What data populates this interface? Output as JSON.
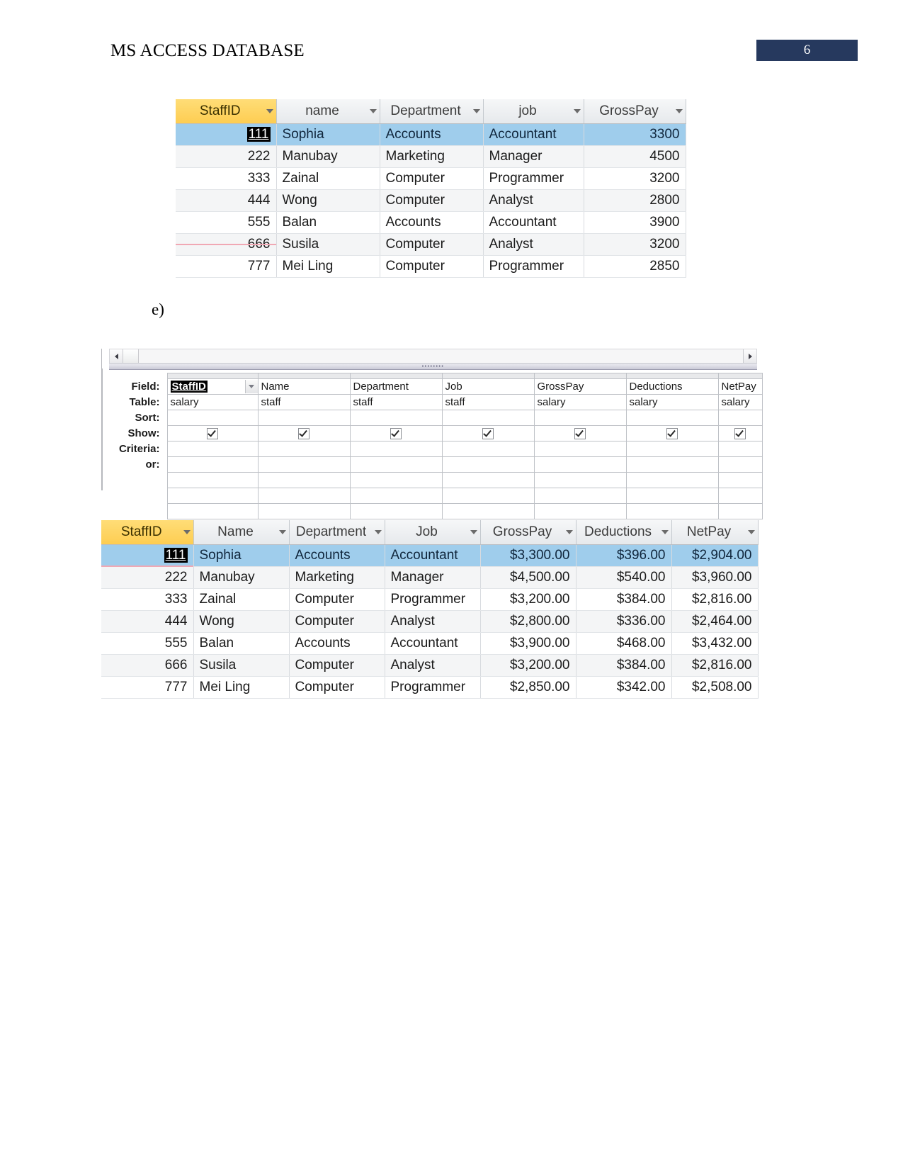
{
  "header": {
    "title": "MS ACCESS DATABASE",
    "page_number": "6",
    "page_box_color": "#26395e"
  },
  "list_label": "e)",
  "staff_table": {
    "columns": [
      "StaffID",
      "name",
      "Department",
      "job",
      "GrossPay"
    ],
    "highlight_column": "StaffID",
    "highlight_color": "#fdcd52",
    "selected_row_color": "#9fcdec",
    "selected_row_index": 0,
    "rows": [
      {
        "staffid": "111",
        "name": "Sophia",
        "department": "Accounts",
        "job": "Accountant",
        "grosspay": "3300"
      },
      {
        "staffid": "222",
        "name": "Manubay",
        "department": "Marketing",
        "job": "Manager",
        "grosspay": "4500"
      },
      {
        "staffid": "333",
        "name": "Zainal",
        "department": "Computer",
        "job": "Programmer",
        "grosspay": "3200"
      },
      {
        "staffid": "444",
        "name": "Wong",
        "department": "Computer",
        "job": "Analyst",
        "grosspay": "2800"
      },
      {
        "staffid": "555",
        "name": "Balan",
        "department": "Accounts",
        "job": "Accountant",
        "grosspay": "3900"
      },
      {
        "staffid": "666",
        "name": "Susila",
        "department": "Computer",
        "job": "Analyst",
        "grosspay": "3200"
      },
      {
        "staffid": "777",
        "name": "Mei Ling",
        "department": "Computer",
        "job": "Programmer",
        "grosspay": "2850"
      }
    ]
  },
  "query_design": {
    "row_labels": [
      "Field:",
      "Table:",
      "Sort:",
      "Show:",
      "Criteria:",
      "or:"
    ],
    "columns": [
      {
        "field": "StaffID",
        "table": "salary",
        "sort": "",
        "show": true,
        "criteria": "",
        "or": "",
        "selected": true
      },
      {
        "field": "Name",
        "table": "staff",
        "sort": "",
        "show": true,
        "criteria": "",
        "or": "",
        "selected": false
      },
      {
        "field": "Department",
        "table": "staff",
        "sort": "",
        "show": true,
        "criteria": "",
        "or": "",
        "selected": false
      },
      {
        "field": "Job",
        "table": "staff",
        "sort": "",
        "show": true,
        "criteria": "",
        "or": "",
        "selected": false
      },
      {
        "field": "GrossPay",
        "table": "salary",
        "sort": "",
        "show": true,
        "criteria": "",
        "or": "",
        "selected": false
      },
      {
        "field": "Deductions",
        "table": "salary",
        "sort": "",
        "show": true,
        "criteria": "",
        "or": "",
        "selected": false
      },
      {
        "field": "NetPay",
        "table": "salary",
        "sort": "",
        "show": true,
        "criteria": "",
        "or": "",
        "selected": false
      }
    ]
  },
  "query_result_table": {
    "columns": [
      "StaffID",
      "Name",
      "Department",
      "Job",
      "GrossPay",
      "Deductions",
      "NetPay"
    ],
    "highlight_column": "StaffID",
    "highlight_color": "#fdcd52",
    "selected_row_color": "#9fcdec",
    "selected_row_index": 0,
    "rows": [
      {
        "staffid": "111",
        "name": "Sophia",
        "department": "Accounts",
        "job": "Accountant",
        "grosspay": "$3,300.00",
        "deductions": "$396.00",
        "netpay": "$2,904.00"
      },
      {
        "staffid": "222",
        "name": "Manubay",
        "department": "Marketing",
        "job": "Manager",
        "grosspay": "$4,500.00",
        "deductions": "$540.00",
        "netpay": "$3,960.00"
      },
      {
        "staffid": "333",
        "name": "Zainal",
        "department": "Computer",
        "job": "Programmer",
        "grosspay": "$3,200.00",
        "deductions": "$384.00",
        "netpay": "$2,816.00"
      },
      {
        "staffid": "444",
        "name": "Wong",
        "department": "Computer",
        "job": "Analyst",
        "grosspay": "$2,800.00",
        "deductions": "$336.00",
        "netpay": "$2,464.00"
      },
      {
        "staffid": "555",
        "name": "Balan",
        "department": "Accounts",
        "job": "Accountant",
        "grosspay": "$3,900.00",
        "deductions": "$468.00",
        "netpay": "$3,432.00"
      },
      {
        "staffid": "666",
        "name": "Susila",
        "department": "Computer",
        "job": "Analyst",
        "grosspay": "$3,200.00",
        "deductions": "$384.00",
        "netpay": "$2,816.00"
      },
      {
        "staffid": "777",
        "name": "Mei Ling",
        "department": "Computer",
        "job": "Programmer",
        "grosspay": "$2,850.00",
        "deductions": "$342.00",
        "netpay": "$2,508.00"
      }
    ]
  }
}
